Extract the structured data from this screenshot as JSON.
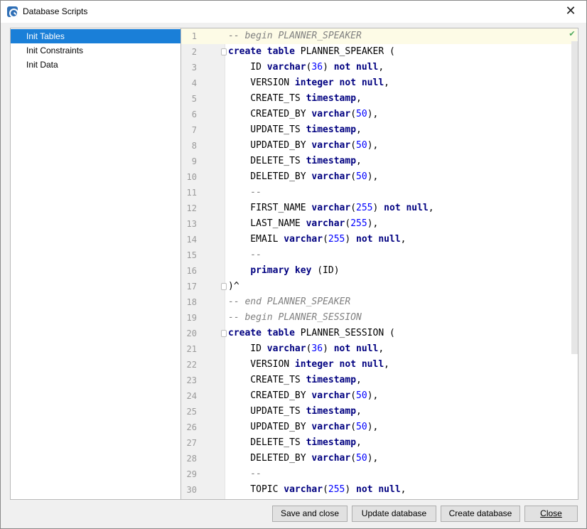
{
  "window": {
    "title": "Database Scripts"
  },
  "sidebar": {
    "items": [
      {
        "label": "Init Tables",
        "selected": true
      },
      {
        "label": "Init Constraints",
        "selected": false
      },
      {
        "label": "Init Data",
        "selected": false
      }
    ]
  },
  "editor": {
    "status_icon": "check-icon",
    "lines": [
      {
        "n": "1",
        "tokens": [
          {
            "t": "-- begin PLANNER_SPEAKER",
            "c": "com"
          }
        ]
      },
      {
        "n": "2",
        "fold": true,
        "tokens": [
          {
            "t": "create table",
            "c": "kw"
          },
          {
            "t": " PLANNER_SPEAKER (",
            "c": ""
          }
        ]
      },
      {
        "n": "3",
        "tokens": [
          {
            "t": "    ID ",
            "c": ""
          },
          {
            "t": "varchar",
            "c": "kw"
          },
          {
            "t": "(",
            "c": ""
          },
          {
            "t": "36",
            "c": "num"
          },
          {
            "t": ") ",
            "c": ""
          },
          {
            "t": "not null",
            "c": "kw"
          },
          {
            "t": ",",
            "c": ""
          }
        ]
      },
      {
        "n": "4",
        "tokens": [
          {
            "t": "    VERSION ",
            "c": ""
          },
          {
            "t": "integer not null",
            "c": "kw"
          },
          {
            "t": ",",
            "c": ""
          }
        ]
      },
      {
        "n": "5",
        "tokens": [
          {
            "t": "    CREATE_TS ",
            "c": ""
          },
          {
            "t": "timestamp",
            "c": "kw"
          },
          {
            "t": ",",
            "c": ""
          }
        ]
      },
      {
        "n": "6",
        "tokens": [
          {
            "t": "    CREATED_BY ",
            "c": ""
          },
          {
            "t": "varchar",
            "c": "kw"
          },
          {
            "t": "(",
            "c": ""
          },
          {
            "t": "50",
            "c": "num"
          },
          {
            "t": "),",
            "c": ""
          }
        ]
      },
      {
        "n": "7",
        "tokens": [
          {
            "t": "    UPDATE_TS ",
            "c": ""
          },
          {
            "t": "timestamp",
            "c": "kw"
          },
          {
            "t": ",",
            "c": ""
          }
        ]
      },
      {
        "n": "8",
        "tokens": [
          {
            "t": "    UPDATED_BY ",
            "c": ""
          },
          {
            "t": "varchar",
            "c": "kw"
          },
          {
            "t": "(",
            "c": ""
          },
          {
            "t": "50",
            "c": "num"
          },
          {
            "t": "),",
            "c": ""
          }
        ]
      },
      {
        "n": "9",
        "tokens": [
          {
            "t": "    DELETE_TS ",
            "c": ""
          },
          {
            "t": "timestamp",
            "c": "kw"
          },
          {
            "t": ",",
            "c": ""
          }
        ]
      },
      {
        "n": "10",
        "tokens": [
          {
            "t": "    DELETED_BY ",
            "c": ""
          },
          {
            "t": "varchar",
            "c": "kw"
          },
          {
            "t": "(",
            "c": ""
          },
          {
            "t": "50",
            "c": "num"
          },
          {
            "t": "),",
            "c": ""
          }
        ]
      },
      {
        "n": "11",
        "tokens": [
          {
            "t": "    --",
            "c": "com"
          }
        ]
      },
      {
        "n": "12",
        "tokens": [
          {
            "t": "    FIRST_NAME ",
            "c": ""
          },
          {
            "t": "varchar",
            "c": "kw"
          },
          {
            "t": "(",
            "c": ""
          },
          {
            "t": "255",
            "c": "num"
          },
          {
            "t": ") ",
            "c": ""
          },
          {
            "t": "not null",
            "c": "kw"
          },
          {
            "t": ",",
            "c": ""
          }
        ]
      },
      {
        "n": "13",
        "tokens": [
          {
            "t": "    LAST_NAME ",
            "c": ""
          },
          {
            "t": "varchar",
            "c": "kw"
          },
          {
            "t": "(",
            "c": ""
          },
          {
            "t": "255",
            "c": "num"
          },
          {
            "t": "),",
            "c": ""
          }
        ]
      },
      {
        "n": "14",
        "tokens": [
          {
            "t": "    EMAIL ",
            "c": ""
          },
          {
            "t": "varchar",
            "c": "kw"
          },
          {
            "t": "(",
            "c": ""
          },
          {
            "t": "255",
            "c": "num"
          },
          {
            "t": ") ",
            "c": ""
          },
          {
            "t": "not null",
            "c": "kw"
          },
          {
            "t": ",",
            "c": ""
          }
        ]
      },
      {
        "n": "15",
        "tokens": [
          {
            "t": "    --",
            "c": "com"
          }
        ]
      },
      {
        "n": "16",
        "tokens": [
          {
            "t": "    ",
            "c": ""
          },
          {
            "t": "primary key",
            "c": "kw"
          },
          {
            "t": " (ID)",
            "c": ""
          }
        ]
      },
      {
        "n": "17",
        "fold": true,
        "tokens": [
          {
            "t": ")^",
            "c": ""
          }
        ]
      },
      {
        "n": "18",
        "tokens": [
          {
            "t": "-- end PLANNER_SPEAKER",
            "c": "com"
          }
        ]
      },
      {
        "n": "19",
        "tokens": [
          {
            "t": "-- begin PLANNER_SESSION",
            "c": "com"
          }
        ]
      },
      {
        "n": "20",
        "fold": true,
        "tokens": [
          {
            "t": "create table",
            "c": "kw"
          },
          {
            "t": " PLANNER_SESSION (",
            "c": ""
          }
        ]
      },
      {
        "n": "21",
        "tokens": [
          {
            "t": "    ID ",
            "c": ""
          },
          {
            "t": "varchar",
            "c": "kw"
          },
          {
            "t": "(",
            "c": ""
          },
          {
            "t": "36",
            "c": "num"
          },
          {
            "t": ") ",
            "c": ""
          },
          {
            "t": "not null",
            "c": "kw"
          },
          {
            "t": ",",
            "c": ""
          }
        ]
      },
      {
        "n": "22",
        "tokens": [
          {
            "t": "    VERSION ",
            "c": ""
          },
          {
            "t": "integer not null",
            "c": "kw"
          },
          {
            "t": ",",
            "c": ""
          }
        ]
      },
      {
        "n": "23",
        "tokens": [
          {
            "t": "    CREATE_TS ",
            "c": ""
          },
          {
            "t": "timestamp",
            "c": "kw"
          },
          {
            "t": ",",
            "c": ""
          }
        ]
      },
      {
        "n": "24",
        "tokens": [
          {
            "t": "    CREATED_BY ",
            "c": ""
          },
          {
            "t": "varchar",
            "c": "kw"
          },
          {
            "t": "(",
            "c": ""
          },
          {
            "t": "50",
            "c": "num"
          },
          {
            "t": "),",
            "c": ""
          }
        ]
      },
      {
        "n": "25",
        "tokens": [
          {
            "t": "    UPDATE_TS ",
            "c": ""
          },
          {
            "t": "timestamp",
            "c": "kw"
          },
          {
            "t": ",",
            "c": ""
          }
        ]
      },
      {
        "n": "26",
        "tokens": [
          {
            "t": "    UPDATED_BY ",
            "c": ""
          },
          {
            "t": "varchar",
            "c": "kw"
          },
          {
            "t": "(",
            "c": ""
          },
          {
            "t": "50",
            "c": "num"
          },
          {
            "t": "),",
            "c": ""
          }
        ]
      },
      {
        "n": "27",
        "tokens": [
          {
            "t": "    DELETE_TS ",
            "c": ""
          },
          {
            "t": "timestamp",
            "c": "kw"
          },
          {
            "t": ",",
            "c": ""
          }
        ]
      },
      {
        "n": "28",
        "tokens": [
          {
            "t": "    DELETED_BY ",
            "c": ""
          },
          {
            "t": "varchar",
            "c": "kw"
          },
          {
            "t": "(",
            "c": ""
          },
          {
            "t": "50",
            "c": "num"
          },
          {
            "t": "),",
            "c": ""
          }
        ]
      },
      {
        "n": "29",
        "tokens": [
          {
            "t": "    --",
            "c": "com"
          }
        ]
      },
      {
        "n": "30",
        "tokens": [
          {
            "t": "    TOPIC ",
            "c": ""
          },
          {
            "t": "varchar",
            "c": "kw"
          },
          {
            "t": "(",
            "c": ""
          },
          {
            "t": "255",
            "c": "num"
          },
          {
            "t": ") ",
            "c": ""
          },
          {
            "t": "not null",
            "c": "kw"
          },
          {
            "t": ",",
            "c": ""
          }
        ]
      }
    ]
  },
  "buttons": {
    "save_and_close": "Save and close",
    "update_database": "Update database",
    "create_database": "Create database",
    "close": "Close"
  },
  "icons": {
    "app": "database-scripts-app-icon",
    "close": "close-icon"
  }
}
